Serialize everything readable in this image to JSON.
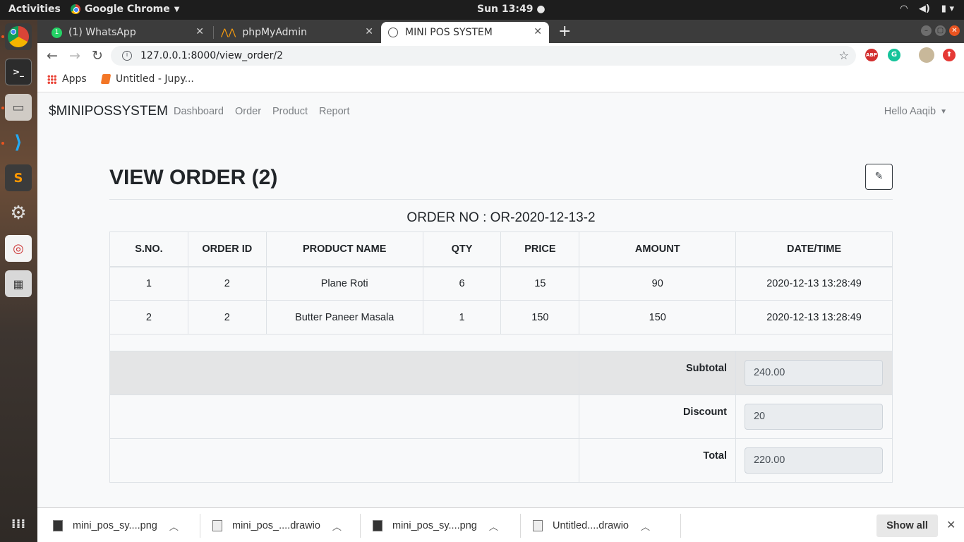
{
  "os": {
    "activities": "Activities",
    "app_name": "Google Chrome",
    "clock": "Sun 13:49 ●"
  },
  "tabs": [
    {
      "title": "(1) WhatsApp",
      "icon": "whatsapp-icon"
    },
    {
      "title": "phpMyAdmin",
      "icon": "phpmyadmin-icon"
    },
    {
      "title": "MINI POS SYSTEM",
      "icon": "globe-icon",
      "active": true
    }
  ],
  "address": {
    "url": "127.0.0.1:8000/view_order/2"
  },
  "bookmarks": [
    {
      "label": "Apps",
      "icon": "apps-grid-icon"
    },
    {
      "label": "Untitled - Jupy...",
      "icon": "jupyter-icon"
    }
  ],
  "navbar": {
    "brand": "$MINIPOSSYSTEM",
    "links": [
      "Dashboard",
      "Order",
      "Product",
      "Report"
    ],
    "user": "Hello Aaqib"
  },
  "page": {
    "title": "VIEW ORDER (2)",
    "order_no": "ORDER NO : OR-2020-12-13-2"
  },
  "table": {
    "headers": [
      "S.NO.",
      "ORDER ID",
      "PRODUCT NAME",
      "QTY",
      "PRICE",
      "AMOUNT",
      "DATE/TIME"
    ],
    "rows": [
      [
        "1",
        "2",
        "Plane Roti",
        "6",
        "15",
        "90",
        "2020-12-13 13:28:49"
      ],
      [
        "2",
        "2",
        "Butter Paneer Masala",
        "1",
        "150",
        "150",
        "2020-12-13 13:28:49"
      ]
    ]
  },
  "totals": {
    "subtotal_label": "Subtotal",
    "subtotal": "240.00",
    "discount_label": "Discount",
    "discount": "20",
    "total_label": "Total",
    "total": "220.00"
  },
  "downloads": {
    "items": [
      {
        "name": "mini_pos_sy....png",
        "type": "png"
      },
      {
        "name": "mini_pos_....drawio",
        "type": "drawio"
      },
      {
        "name": "mini_pos_sy....png",
        "type": "png"
      },
      {
        "name": "Untitled....drawio",
        "type": "drawio"
      }
    ],
    "show_all": "Show all"
  }
}
